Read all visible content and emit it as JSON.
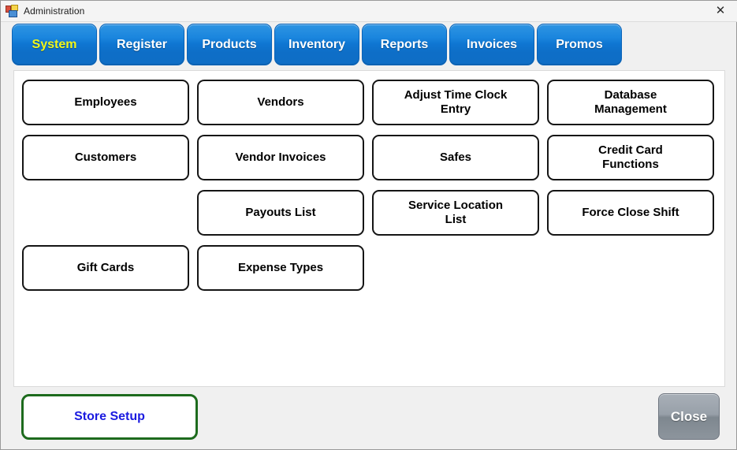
{
  "window": {
    "title": "Administration",
    "app_icon": "application-icon",
    "close_icon": "close-icon",
    "background_color": "#f0f0f0"
  },
  "tabs": {
    "active_index": 0,
    "active_text_color": "#f2f71a",
    "tab_color": "#0f76d2",
    "items": [
      {
        "label": "System"
      },
      {
        "label": "Register"
      },
      {
        "label": "Products"
      },
      {
        "label": "Inventory"
      },
      {
        "label": "Reports"
      },
      {
        "label": "Invoices"
      },
      {
        "label": "Promos"
      }
    ]
  },
  "main": {
    "buttons": [
      {
        "label": "Employees",
        "empty": false
      },
      {
        "label": "Vendors",
        "empty": false
      },
      {
        "label": "Adjust Time Clock\nEntry",
        "empty": false
      },
      {
        "label": "Database\nManagement",
        "empty": false
      },
      {
        "label": "Customers",
        "empty": false
      },
      {
        "label": "Vendor Invoices",
        "empty": false
      },
      {
        "label": "Safes",
        "empty": false
      },
      {
        "label": "Credit Card\nFunctions",
        "empty": false
      },
      {
        "label": "",
        "empty": true
      },
      {
        "label": "Payouts List",
        "empty": false
      },
      {
        "label": "Service Location\nList",
        "empty": false
      },
      {
        "label": "Force Close Shift",
        "empty": false
      },
      {
        "label": "Gift Cards",
        "empty": false
      },
      {
        "label": "Expense Types",
        "empty": false
      },
      {
        "label": "",
        "empty": true
      },
      {
        "label": "",
        "empty": true
      }
    ]
  },
  "footer": {
    "store_setup_label": "Store Setup",
    "store_setup_border_color": "#1d6b1d",
    "store_setup_text_color": "#1a1ae0",
    "close_label": "Close"
  }
}
